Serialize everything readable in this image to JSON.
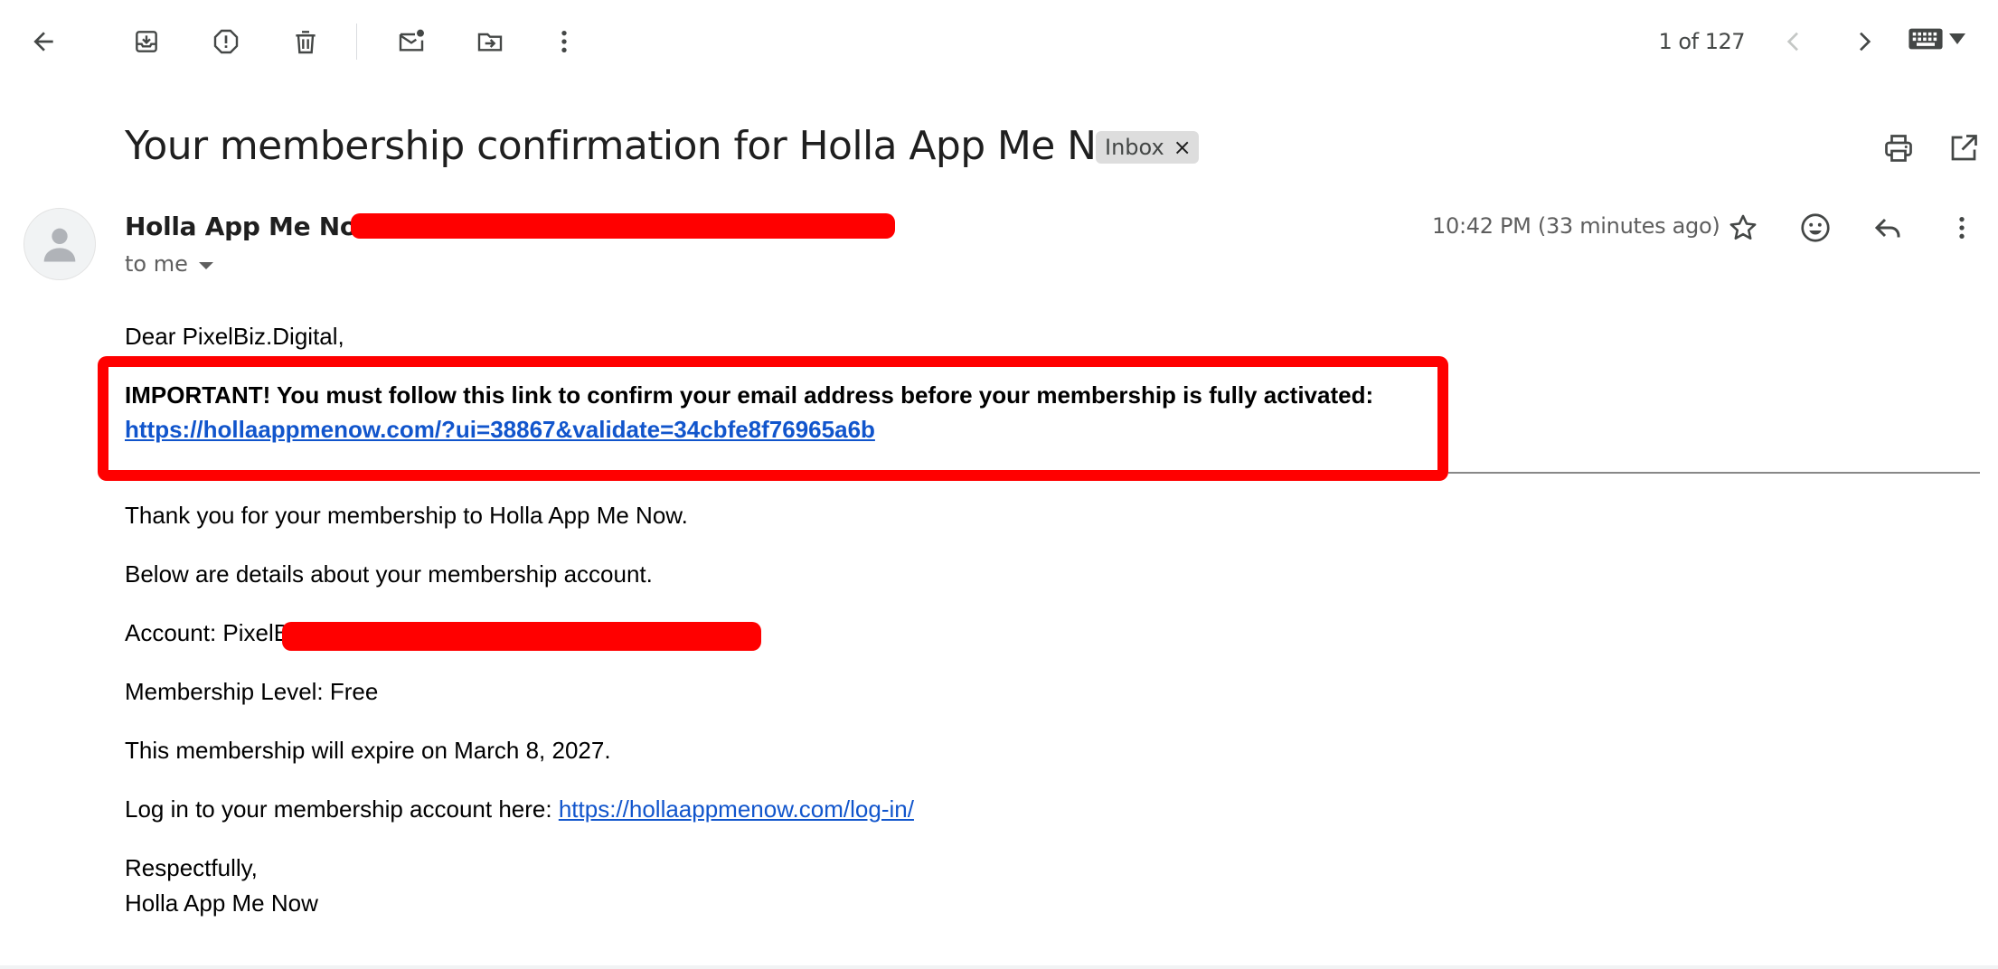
{
  "toolbar": {
    "pager_text": "1 of 127"
  },
  "message": {
    "subject": "Your membership confirmation for Holla App Me Now",
    "label": "Inbox",
    "label_remove": "×",
    "sender_name": "Holla App Me Now",
    "recipient": "to me",
    "timestamp": "10:42 PM (33 minutes ago)"
  },
  "body": {
    "greeting": "Dear PixelBiz.Digital,",
    "important_text": "IMPORTANT! You must follow this link to confirm your email address before your membership is fully activated:",
    "confirm_link": "https://hollaappmenow.com/?ui=38867&validate=34cbfe8f76965a6b",
    "thanks": "Thank you for your membership to Holla App Me Now.",
    "details_intro": "Below are details about your membership account.",
    "account_prefix": "Account: PixelB",
    "membership_level": "Membership Level: Free",
    "expiry": "This membership will expire on March 8, 2027.",
    "login_prefix": "Log in to your membership account here: ",
    "login_link": "https://hollaappmenow.com/log-in/",
    "signoff": "Respectfully,",
    "signature": "Holla App Me Now"
  },
  "colors": {
    "redaction": "#ff0000",
    "link": "#1155cc",
    "chip_bg": "#dddddd"
  },
  "icons": {
    "back": "arrow-left",
    "archive": "archive-box",
    "spam": "report-exclamation",
    "delete": "trash-can",
    "mark_unread": "envelope-dot",
    "move": "folder-arrow",
    "more": "vertical-dots",
    "prev": "chevron-left",
    "next": "chevron-right",
    "keyboard": "keyboard",
    "print": "printer",
    "open_new_window": "external-link",
    "star": "star-outline",
    "emoji": "smiley-face",
    "reply": "reply-arrow"
  }
}
